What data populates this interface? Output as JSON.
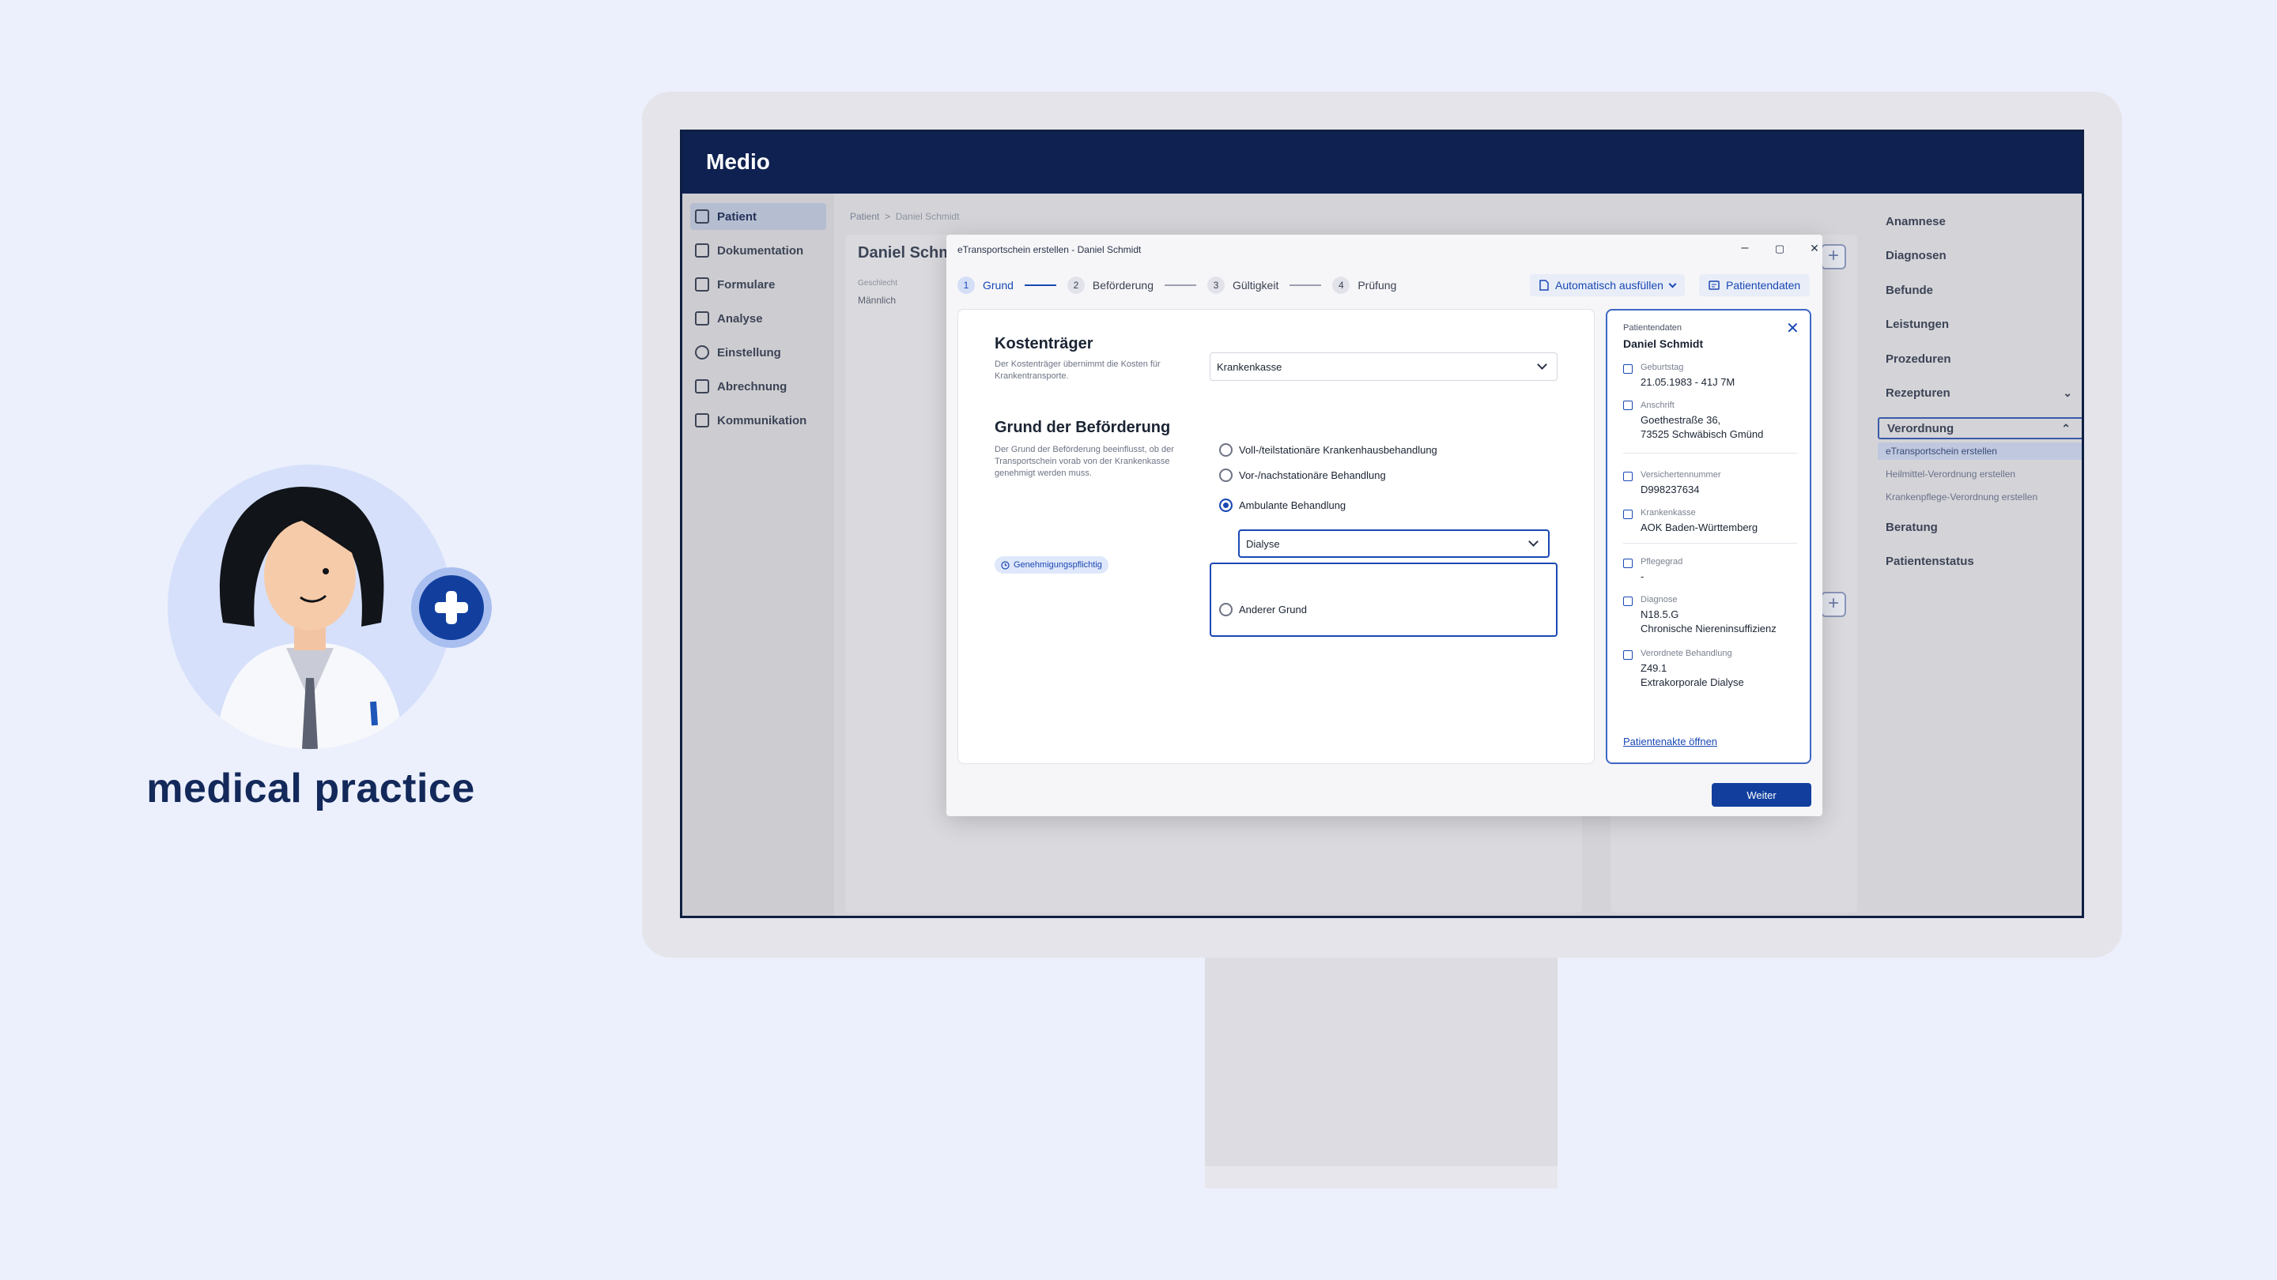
{
  "persona": {
    "caption": "medical practice"
  },
  "app": {
    "name": "Medio"
  },
  "sidebar": {
    "items": [
      {
        "label": "Patient",
        "icon": "user-icon",
        "active": true
      },
      {
        "label": "Dokumentation",
        "icon": "document-icon"
      },
      {
        "label": "Formulare",
        "icon": "form-icon"
      },
      {
        "label": "Analyse",
        "icon": "chart-icon"
      },
      {
        "label": "Einstellung",
        "icon": "gear-icon"
      },
      {
        "label": "Abrechnung",
        "icon": "invoice-icon"
      },
      {
        "label": "Kommunikation",
        "icon": "chat-icon"
      }
    ]
  },
  "breadcrumb": {
    "root": "Patient",
    "separator": ">",
    "current": "Daniel Schmidt"
  },
  "background_patient": {
    "name": "Daniel Schm",
    "gender_label": "Geschlecht",
    "gender_value": "Männlich"
  },
  "right_nav": {
    "items": [
      "Anamnese",
      "Diagnosen",
      "Befunde",
      "Leistungen",
      "Prozeduren",
      "Rezepturen"
    ],
    "open_item": "Verordnung",
    "sub_items": [
      "eTransportschein erstellen",
      "Heilmittel-Verordnung erstellen",
      "Krankenpflege-Verordnung erstellen"
    ],
    "after_items": [
      "Beratung",
      "Patientenstatus"
    ]
  },
  "dialog": {
    "title": "eTransportschein erstellen - Daniel Schmidt",
    "window_controls": {
      "minimize": "–",
      "maximize": "▢",
      "close": "✕"
    },
    "steps": [
      {
        "num": "1",
        "label": "Grund",
        "active": true
      },
      {
        "num": "2",
        "label": "Beförderung"
      },
      {
        "num": "3",
        "label": "Gültigkeit"
      },
      {
        "num": "4",
        "label": "Prüfung"
      }
    ],
    "autofill_label": "Automatisch ausfüllen",
    "patientdata_label": "Patientendaten",
    "kostentraeger": {
      "title": "Kostenträger",
      "desc": "Der Kostenträger übernimmt die Kosten für Krankentransporte.",
      "value": "Krankenkasse"
    },
    "grund": {
      "title": "Grund der Beförderung",
      "desc": "Der Grund der Beförderung beeinflusst, ob der Transportschein vorab von der Krankenkasse genehmigt werden muss.",
      "chip": "Genehmigungspflichtig",
      "options": [
        "Voll-/teilstationäre Krankenhausbehandlung",
        "Vor-/nachstationäre Behandlung",
        "Ambulante Behandlung",
        "Anderer Grund"
      ],
      "selected_index": 2,
      "sub_value": "Dialyse"
    },
    "patient_panel": {
      "heading": "Patientendaten",
      "name": "Daniel Schmidt",
      "fields": [
        {
          "label": "Geburtstag",
          "value": "21.05.1983 - 41J 7M",
          "icon": "calendar-icon"
        },
        {
          "label": "Anschrift",
          "value": "Goethestraße 36,",
          "value2": "73525 Schwäbisch Gmünd",
          "icon": "home-icon"
        },
        {
          "label": "Versichertennummer",
          "value": "D998237634",
          "icon": "id-card-icon"
        },
        {
          "label": "Krankenkasse",
          "value": "AOK Baden-Württemberg",
          "icon": "building-icon"
        },
        {
          "label": "Pflegegrad",
          "value": "-",
          "icon": "heart-hand-icon"
        },
        {
          "label": "Diagnose",
          "value": "N18.5.G",
          "value2": "Chronische Niereninsuffizienz",
          "icon": "stethoscope-icon"
        },
        {
          "label": "Verordnete Behandlung",
          "value": "Z49.1",
          "value2": "Extrakorporale Dialyse",
          "icon": "clipboard-icon"
        }
      ],
      "link": "Patientenakte öffnen"
    },
    "next_label": "Weiter"
  }
}
